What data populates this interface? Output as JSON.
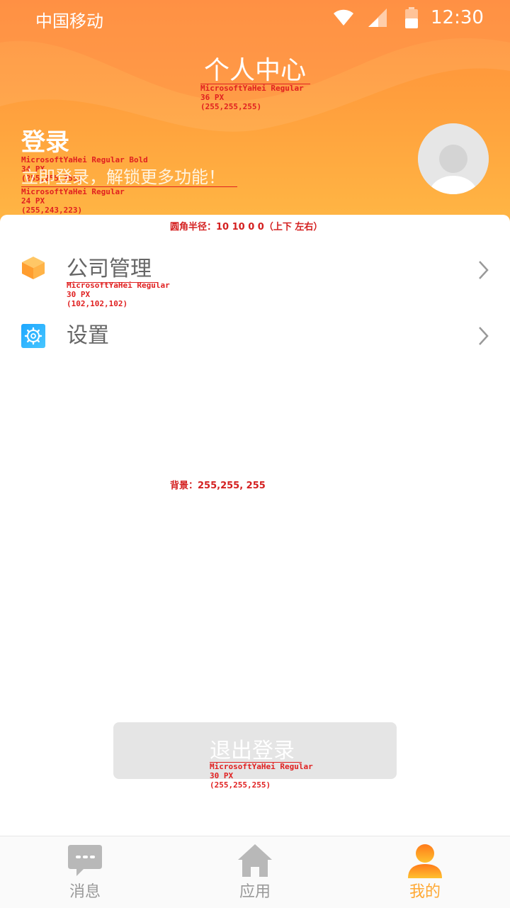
{
  "status_bar": {
    "carrier": "中国移动",
    "time": "12:30"
  },
  "header": {
    "title": "个人中心",
    "login_label": "登录",
    "subtitle": "立即登录，解锁更多功能！"
  },
  "menu": [
    {
      "label": "公司管理",
      "icon": "package-icon"
    },
    {
      "label": "设置",
      "icon": "gear-icon"
    }
  ],
  "logout_label": "退出登录",
  "tabs": [
    {
      "label": "消息",
      "icon": "message-icon",
      "active": false
    },
    {
      "label": "应用",
      "icon": "home-icon",
      "active": false
    },
    {
      "label": "我的",
      "icon": "person-icon",
      "active": true
    }
  ],
  "annotations": {
    "title": "MicrosoftYaHei Regular\n36 PX\n(255,255,255)",
    "login": "MicrosoftYaHei Regular Bold\n34 PX\n(255,255,255)",
    "subtitle": "MicrosoftYaHei Regular\n24 PX\n(255,243,223)",
    "radius": "圆角半径：10 10 0 0（上下 左右）",
    "menu": "MicrosoftYaHei Regular\n30 PX\n(102,102,102)",
    "background": "背景：255,255, 255",
    "logout": "MicrosoftYaHei Regular\n30 PX\n(255,255,255)"
  },
  "colors": {
    "header_start": "#ff8d3a",
    "header_end": "#ffb845",
    "menu_text": "#666666",
    "tab_inactive": "#999999",
    "tab_active": "#ffa833",
    "logout_bg": "#e5e5e5"
  }
}
